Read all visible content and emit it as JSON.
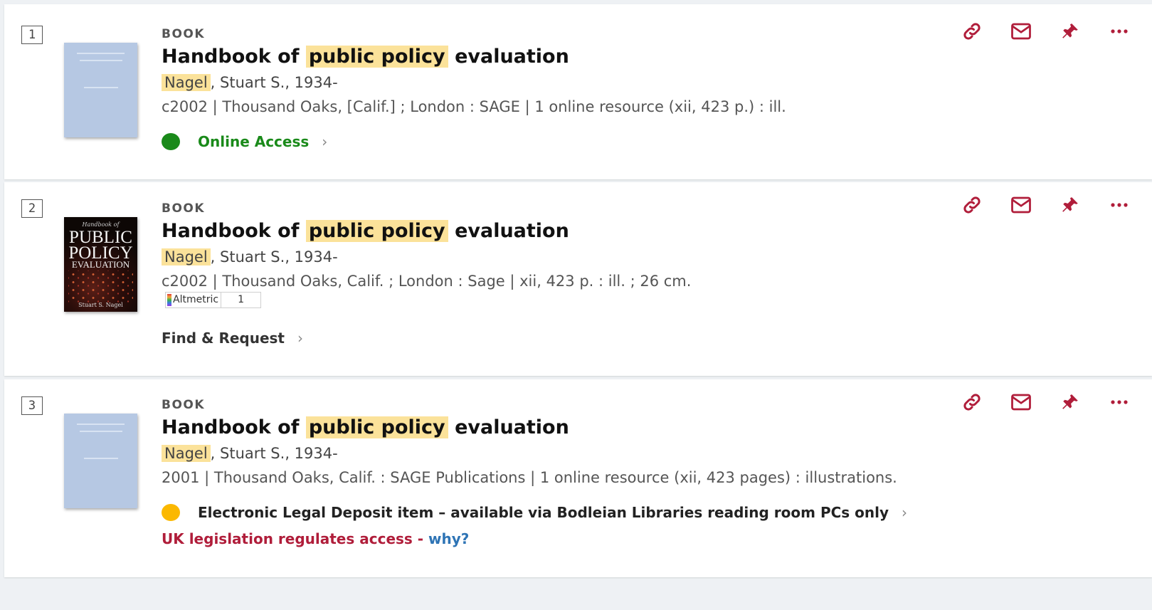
{
  "colors": {
    "action_red": "#b01d3a",
    "online_green": "#1a8a1a",
    "legal_amber": "#fbb800",
    "highlight": "#fbe29a",
    "link_blue": "#2e74b5"
  },
  "results": [
    {
      "number": "1",
      "type": "BOOK",
      "title_pre": "Handbook of",
      "title_hl": "public policy",
      "title_post": "evaluation",
      "author_hl": "Nagel",
      "author_rest": ", Stuart S., 1934-",
      "publication": "c2002 | Thousand Oaks, [Calif.] ; London : SAGE | 1 online resource (xii, 423 p.) : ill.",
      "cover": "placeholder",
      "status_label": "Online Access",
      "status_icon": "green-dot-icon"
    },
    {
      "number": "2",
      "type": "BOOK",
      "title_pre": "Handbook of",
      "title_hl": "public policy",
      "title_post": "evaluation",
      "author_hl": "Nagel",
      "author_rest": ", Stuart S., 1934-",
      "publication": "c2002 | Thousand Oaks, Calif. ; London : Sage | xii, 423 p. : ill. ; 26 cm.",
      "cover": "image",
      "cover_text": {
        "top": "Handbook of",
        "line1": "PUBLIC",
        "line2": "POLICY",
        "line3": "EVALUATION",
        "author": "Stuart S. Nagel"
      },
      "altmetric_label": "Altmetric",
      "altmetric_score": "1",
      "status_label": "Find & Request"
    },
    {
      "number": "3",
      "type": "BOOK",
      "title_pre": "Handbook of",
      "title_hl": "public policy",
      "title_post": "evaluation",
      "author_hl": "Nagel",
      "author_rest": ", Stuart S., 1934-",
      "publication": "2001 | Thousand Oaks, Calif. : SAGE Publications | 1 online resource (xii, 423 pages) : illustrations.",
      "cover": "placeholder",
      "status_label": "Electronic Legal Deposit item – available via Bodleian Libraries reading room PCs only",
      "status_icon": "amber-dot-icon",
      "legal_note": "UK legislation regulates access -",
      "legal_link": "why?"
    }
  ],
  "actions": [
    {
      "name": "permalink-icon"
    },
    {
      "name": "email-icon"
    },
    {
      "name": "pin-icon"
    },
    {
      "name": "more-icon"
    }
  ]
}
